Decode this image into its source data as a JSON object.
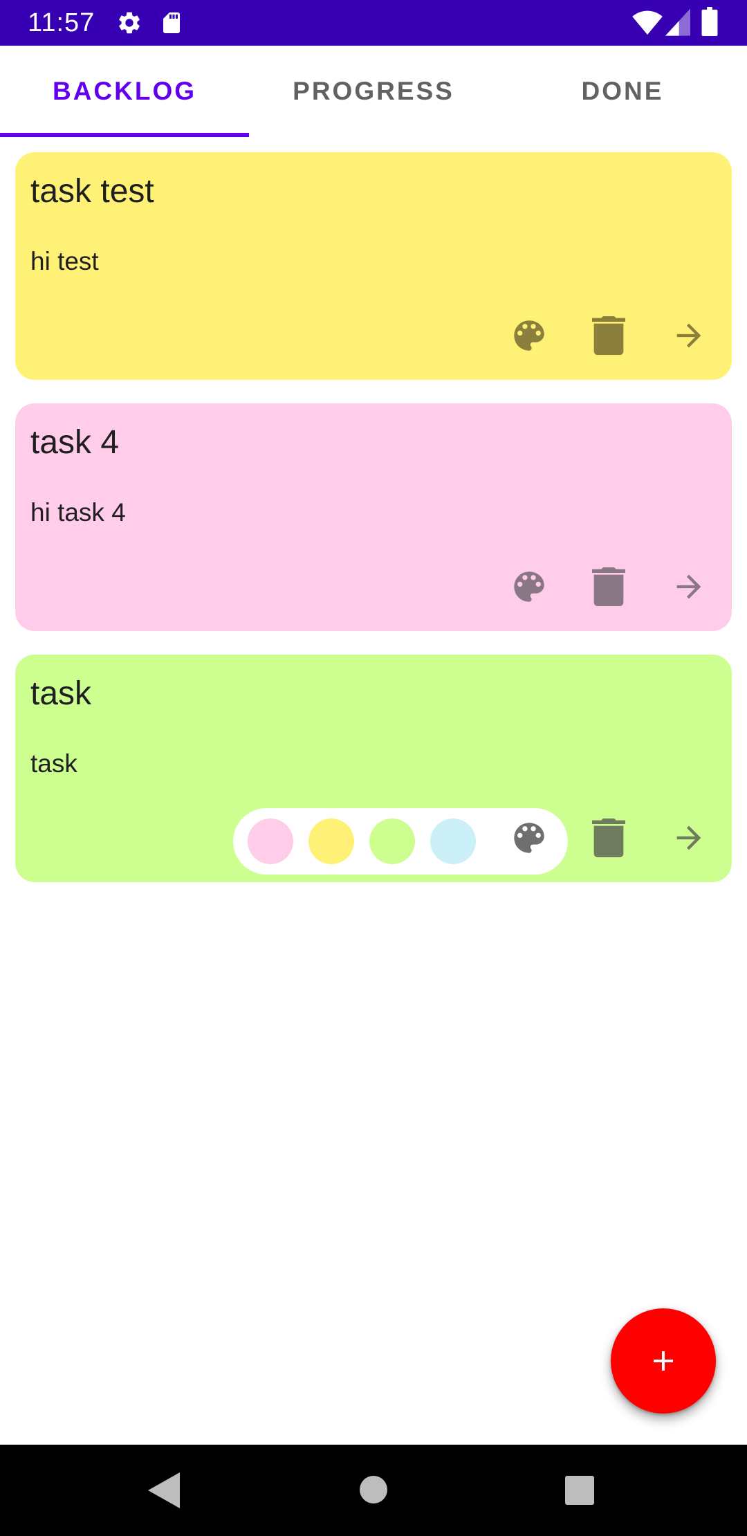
{
  "status_bar": {
    "time": "11:57",
    "icons": [
      "settings-icon",
      "sd-card-icon",
      "wifi-icon",
      "signal-icon",
      "battery-icon"
    ],
    "color": "#3700b3"
  },
  "tabs": [
    {
      "label": "BACKLOG",
      "active": true
    },
    {
      "label": "PROGRESS",
      "active": false
    },
    {
      "label": "DONE",
      "active": false
    }
  ],
  "accent_color": "#6200ee",
  "cards": [
    {
      "title": "task test",
      "description": "hi test",
      "color": "#fff176",
      "icon_color": "#8a7f3c",
      "color_picker_open": false
    },
    {
      "title": "task 4",
      "description": "hi task 4",
      "color": "#ffcce9",
      "icon_color": "#8a7785",
      "color_picker_open": false
    },
    {
      "title": "task",
      "description": "task",
      "color": "#ccff90",
      "icon_color": "#6f7b5f",
      "color_picker_open": true
    }
  ],
  "card_actions": [
    "palette-icon",
    "delete-icon",
    "arrow-forward-icon"
  ],
  "color_options": [
    "#ffcce9",
    "#fff176",
    "#ccff90",
    "#ccf0f7"
  ],
  "fab": {
    "icon": "plus-icon",
    "color": "#ff0000"
  },
  "nav_bar": {
    "buttons": [
      "back-icon",
      "home-icon",
      "recents-icon"
    ]
  }
}
